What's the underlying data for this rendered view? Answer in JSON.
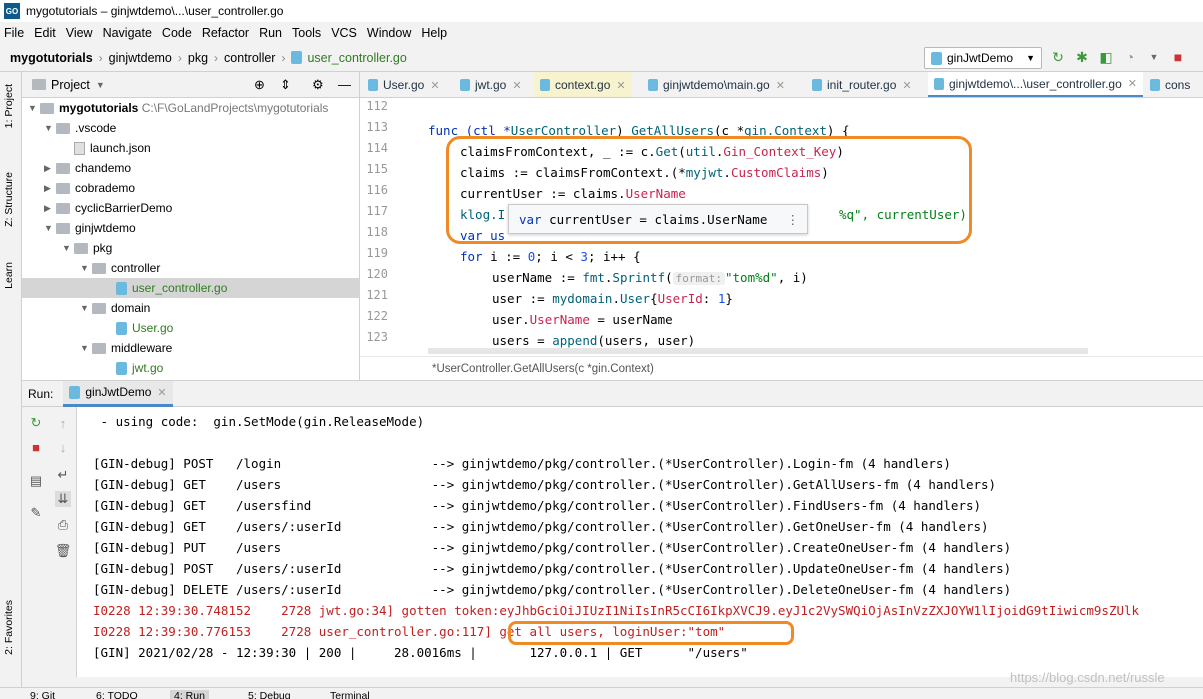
{
  "window": {
    "title": "mygotutorials – ginjwtdemo\\...\\user_controller.go",
    "logo": "GO"
  },
  "menu": [
    "File",
    "Edit",
    "View",
    "Navigate",
    "Code",
    "Refactor",
    "Run",
    "Tools",
    "VCS",
    "Window",
    "Help"
  ],
  "breadcrumb": [
    "mygotutorials",
    "ginjwtdemo",
    "pkg",
    "controller",
    "user_controller.go"
  ],
  "run_config": "ginJwtDemo",
  "side_tabs": {
    "project": "1: Project",
    "structure": "Z: Structure",
    "learn": "Learn",
    "favorites": "2: Favorites"
  },
  "project_panel": {
    "title": "Project",
    "tree": [
      {
        "label": "mygotutorials",
        "path": "C:\\F\\GoLandProjects\\mygotutorials",
        "kind": "folder",
        "depth": 0,
        "open": true
      },
      {
        "label": ".vscode",
        "kind": "folder",
        "depth": 1,
        "open": true
      },
      {
        "label": "launch.json",
        "kind": "json",
        "depth": 2
      },
      {
        "label": "chandemo",
        "kind": "folder",
        "depth": 1,
        "open": false
      },
      {
        "label": "cobrademo",
        "kind": "folder",
        "depth": 1,
        "open": false
      },
      {
        "label": "cyclicBarrierDemo",
        "kind": "folder",
        "depth": 1,
        "open": false
      },
      {
        "label": "ginjwtdemo",
        "kind": "folder",
        "depth": 1,
        "open": true
      },
      {
        "label": "pkg",
        "kind": "folder",
        "depth": 2,
        "open": true
      },
      {
        "label": "controller",
        "kind": "folder",
        "depth": 3,
        "open": true
      },
      {
        "label": "user_controller.go",
        "kind": "go",
        "depth": 4,
        "selected": true
      },
      {
        "label": "domain",
        "kind": "folder",
        "depth": 3,
        "open": true
      },
      {
        "label": "User.go",
        "kind": "go",
        "depth": 4
      },
      {
        "label": "middleware",
        "kind": "folder",
        "depth": 3,
        "open": true
      },
      {
        "label": "jwt.go",
        "kind": "go",
        "depth": 4
      }
    ]
  },
  "editor_tabs": [
    "User.go",
    "jwt.go",
    "context.go",
    "ginjwtdemo\\main.go",
    "init_router.go",
    "ginjwtdemo\\...\\user_controller.go",
    "cons"
  ],
  "line_numbers": [
    "112",
    "113",
    "114",
    "115",
    "116",
    "117",
    "118",
    "119",
    "120",
    "121",
    "122",
    "123"
  ],
  "code": {
    "l113": {
      "a": "func (ctl *",
      "b": "UserController",
      "c": ") ",
      "d": "GetAllUsers",
      "e": "(c *",
      "f": "gin.Context",
      "g": ") {"
    },
    "l114": {
      "a": "claimsFromContext, _ := c.",
      "b": "Get",
      "c": "(",
      "d": "util",
      "e": ".",
      "f": "Gin_Context_Key",
      "g": ")"
    },
    "l115": {
      "a": "claims := claimsFromContext.(*",
      "b": "myjwt",
      "c": ".",
      "d": "CustomClaims",
      "e": ")"
    },
    "l116": {
      "a": "currentUser := claims.",
      "b": "UserName"
    },
    "l117": {
      "a": "klog.I",
      "b": "%q\", currentUser)"
    },
    "l118": {
      "a": "var us"
    },
    "l119": {
      "a": "for",
      "b": " i := ",
      "c": "0",
      "d": "; i < ",
      "e": "3",
      "f": "; i++ {"
    },
    "l120": {
      "a": "userName := ",
      "b": "fmt",
      "c": ".",
      "d": "Sprintf",
      "e": "(",
      "hint": "format:",
      "f": "\"tom%d\"",
      "g": ", i)"
    },
    "l121": {
      "a": "user := ",
      "b": "mydomain",
      "c": ".",
      "d": "User",
      "e": "{",
      "f": "UserId",
      "g": ": ",
      "h": "1",
      "i": "}"
    },
    "l122": {
      "a": "user.",
      "b": "UserName",
      "c": " = userName"
    },
    "l123": {
      "a": "users = ",
      "b": "append",
      "c": "(users, user)"
    }
  },
  "popup": {
    "kw": "var",
    "text": " currentUser = claims.UserName",
    "more": "⋮"
  },
  "editor_footer": "*UserController.GetAllUsers(c *gin.Context)",
  "run_panel": {
    "label": "Run:",
    "tab": "ginJwtDemo"
  },
  "console": [
    {
      "text": " - using code:  gin.SetMode(gin.ReleaseMode)",
      "kind": "normal"
    },
    {
      "text": "",
      "kind": "normal"
    },
    {
      "text": "[GIN-debug] POST   /login                    --> ginjwtdemo/pkg/controller.(*UserController).Login-fm (4 handlers)",
      "kind": "normal"
    },
    {
      "text": "[GIN-debug] GET    /users                    --> ginjwtdemo/pkg/controller.(*UserController).GetAllUsers-fm (4 handlers)",
      "kind": "normal"
    },
    {
      "text": "[GIN-debug] GET    /usersfind                --> ginjwtdemo/pkg/controller.(*UserController).FindUsers-fm (4 handlers)",
      "kind": "normal"
    },
    {
      "text": "[GIN-debug] GET    /users/:userId            --> ginjwtdemo/pkg/controller.(*UserController).GetOneUser-fm (4 handlers)",
      "kind": "normal"
    },
    {
      "text": "[GIN-debug] PUT    /users                    --> ginjwtdemo/pkg/controller.(*UserController).CreateOneUser-fm (4 handlers)",
      "kind": "normal"
    },
    {
      "text": "[GIN-debug] POST   /users/:userId            --> ginjwtdemo/pkg/controller.(*UserController).UpdateOneUser-fm (4 handlers)",
      "kind": "normal"
    },
    {
      "text": "[GIN-debug] DELETE /users/:userId            --> ginjwtdemo/pkg/controller.(*UserController).DeleteOneUser-fm (4 handlers)",
      "kind": "normal"
    },
    {
      "text": "I0228 12:39:30.748152    2728 jwt.go:34] gotten token:eyJhbGciOiJIUzI1NiIsInR5cCI6IkpXVCJ9.eyJ1c2VySWQiOjAsInVzZXJOYW1lIjoidG9tIiwicm9sZUlk",
      "kind": "error"
    },
    {
      "text": "I0228 12:39:30.776153    2728 user_controller.go:117] get all users, loginUser:\"tom\"",
      "kind": "error"
    },
    {
      "text": "[GIN] 2021/02/28 - 12:39:30 | 200 |     28.0016ms |       127.0.0.1 | GET      \"/users\"",
      "kind": "normal"
    }
  ],
  "bottom_tabs": [
    "9: Git",
    "6: TODO",
    "4: Run",
    "5: Debug",
    "Terminal"
  ],
  "watermark": "https://blog.csdn.net/russle",
  "colors": {
    "accent": "#4a88c7",
    "highlight": "#f08a24",
    "error_text": "#c21f1f"
  }
}
